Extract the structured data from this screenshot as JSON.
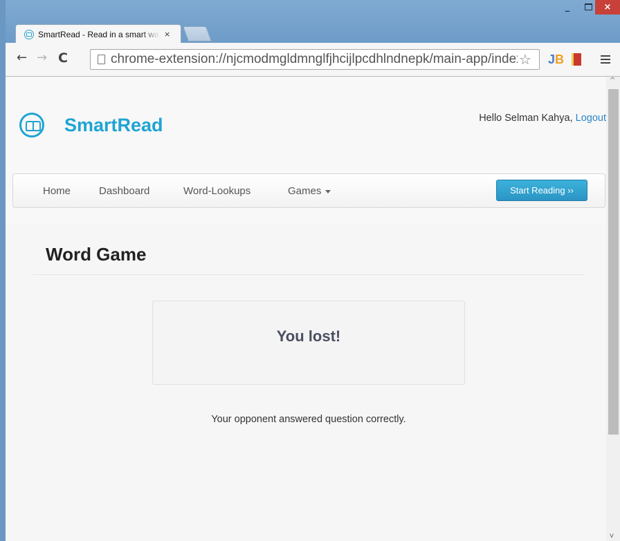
{
  "browser": {
    "tab_title": "SmartRead - Read in a smart way",
    "tab_close": "×",
    "url": "chrome-extension://njcmodmgldmnglfjhcijlpcdhlndnepk/main-app/index.html",
    "window_minimize": "_",
    "window_close": "×",
    "ext_jb": "J",
    "ext_jb_b": "B"
  },
  "header": {
    "brand_name": "SmartRead",
    "greeting": "Hello Selman Kahya,",
    "logout_label": "Logout"
  },
  "nav": {
    "items": [
      {
        "label": "Home"
      },
      {
        "label": "Dashboard"
      },
      {
        "label": "Word-Lookups"
      },
      {
        "label": "Games"
      }
    ],
    "start_button": "Start Reading ››"
  },
  "main": {
    "title": "Word Game",
    "result": "You lost!",
    "message": "Your opponent answered question correctly."
  },
  "colors": {
    "accent": "#1ea4d3",
    "button": "#2b95c4",
    "link": "#2a84c6"
  }
}
